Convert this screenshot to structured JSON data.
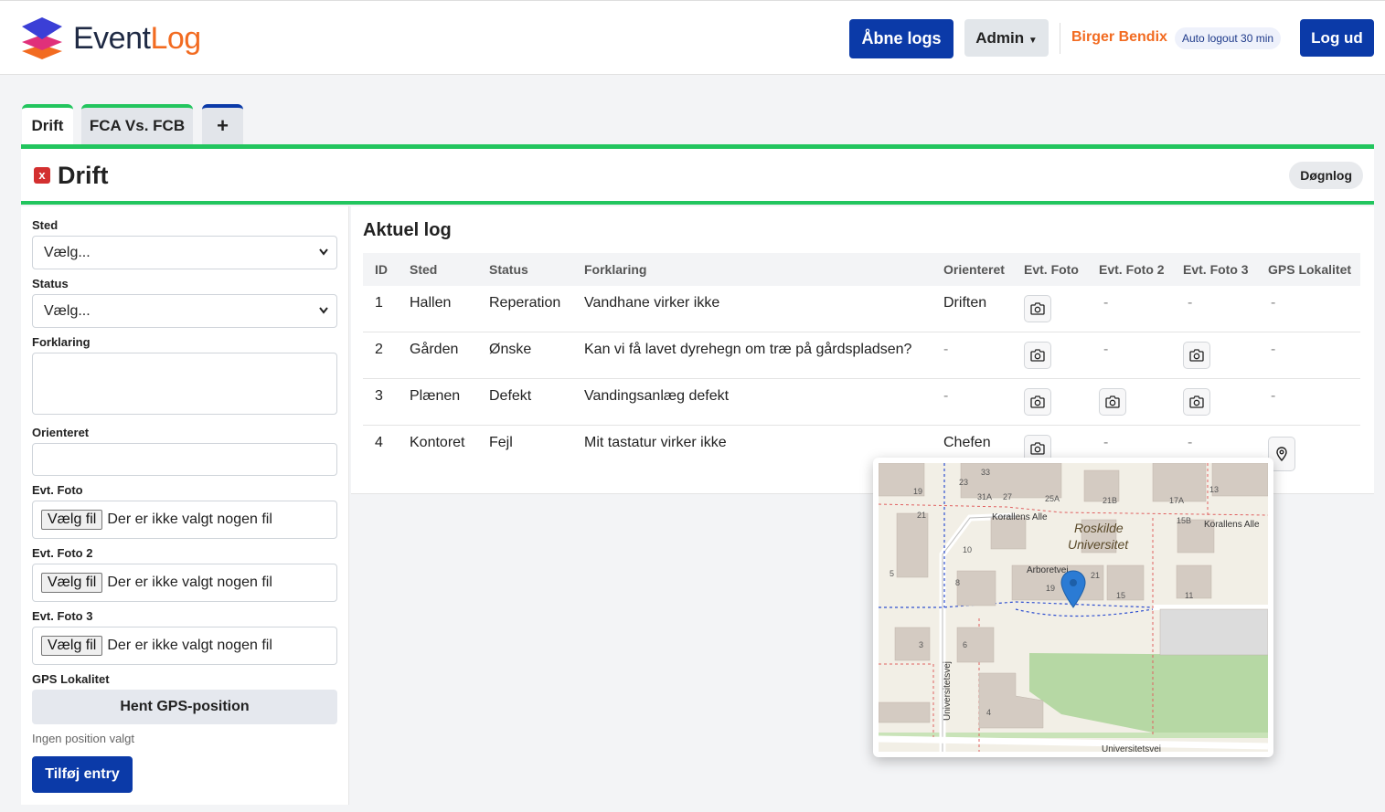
{
  "header": {
    "logo_part1": "Event",
    "logo_part2": "Log",
    "open_logs_label": "Åbne logs",
    "admin_label": "Admin",
    "user_name": "Birger Bendix",
    "auto_logout": "Auto logout 30 min",
    "logout_label": "Log ud"
  },
  "tabs": [
    {
      "label": "Drift"
    },
    {
      "label": "FCA Vs. FCB"
    },
    {
      "label": "+"
    }
  ],
  "panel": {
    "close_glyph": "x",
    "title": "Drift",
    "daily_button": "Døgnlog"
  },
  "form": {
    "sted_label": "Sted",
    "sted_value": "Vælg...",
    "status_label": "Status",
    "status_value": "Vælg...",
    "forklaring_label": "Forklaring",
    "orienteret_label": "Orienteret",
    "foto1_label": "Evt. Foto",
    "foto2_label": "Evt. Foto 2",
    "foto3_label": "Evt. Foto 3",
    "file_button": "Vælg fil",
    "file_none": "Der er ikke valgt nogen fil",
    "gps_label": "GPS Lokalitet",
    "gps_button": "Hent GPS-position",
    "gps_info": "Ingen position valgt",
    "submit": "Tilføj entry"
  },
  "table": {
    "title": "Aktuel log",
    "columns": [
      "ID",
      "Sted",
      "Status",
      "Forklaring",
      "Orienteret",
      "Evt. Foto",
      "Evt. Foto 2",
      "Evt. Foto 3",
      "GPS Lokalitet"
    ],
    "rows": [
      {
        "id": "1",
        "sted": "Hallen",
        "status": "Reperation",
        "forklaring": "Vandhane virker ikke",
        "orienteret": "Driften",
        "foto1": true,
        "foto2": false,
        "foto3": false,
        "gps": false
      },
      {
        "id": "2",
        "sted": "Gården",
        "status": "Ønske",
        "forklaring": "Kan vi få lavet dyrehegn om træ på gårdspladsen?",
        "orienteret": "-",
        "foto1": true,
        "foto2": false,
        "foto3": true,
        "gps": false
      },
      {
        "id": "3",
        "sted": "Plænen",
        "status": "Defekt",
        "forklaring": "Vandingsanlæg defekt",
        "orienteret": "-",
        "foto1": true,
        "foto2": true,
        "foto3": true,
        "gps": false
      },
      {
        "id": "4",
        "sted": "Kontoret",
        "status": "Fejl",
        "forklaring": "Mit tastatur virker ikke",
        "orienteret": "Chefen",
        "foto1": true,
        "foto2": false,
        "foto3": false,
        "gps": true
      }
    ],
    "dash": "-"
  },
  "map": {
    "place_line1": "Roskilde",
    "place_line2": "Universitet",
    "street1": "Korallens Alle",
    "street2": "Korallens Alle",
    "street3": "Arboretvej",
    "street4": "Universitetsvej",
    "street5": "Universitetsvej",
    "numbers": [
      "33",
      "23",
      "19",
      "31A",
      "27",
      "25A",
      "21B",
      "17A",
      "13",
      "15B",
      "21",
      "10",
      "5",
      "8",
      "19",
      "21",
      "15",
      "11",
      "6",
      "3",
      "4"
    ]
  },
  "icons": {
    "logo": "layers-icon",
    "camera": "camera-icon",
    "gps": "map-pin-icon",
    "chevron": "chevron-down-icon"
  },
  "colors": {
    "primary": "#0b3aa8",
    "accent": "#f26b21",
    "success": "#22c55e",
    "danger": "#d32f2f"
  }
}
